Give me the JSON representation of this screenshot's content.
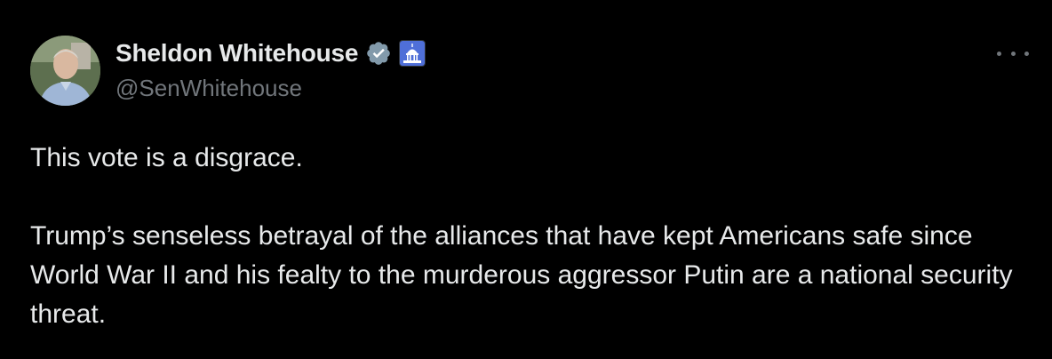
{
  "author": {
    "display_name": "Sheldon Whitehouse",
    "handle": "@SenWhitehouse",
    "verified_color": "#829aab",
    "affiliation_badge_color": "#4f6fd8"
  },
  "tweet": {
    "text": "This vote is a disgrace.\n\nTrump’s senseless betrayal of the alliances that have kept Americans safe since World War II and his fealty to the murderous aggressor Putin are a national security threat."
  },
  "icons": {
    "verified": "verified-badge-icon",
    "affiliation": "capitol-building-icon",
    "more": "more-options-icon"
  },
  "colors": {
    "background": "#000000",
    "primary_text": "#e7e9ea",
    "secondary_text": "#71767b"
  }
}
